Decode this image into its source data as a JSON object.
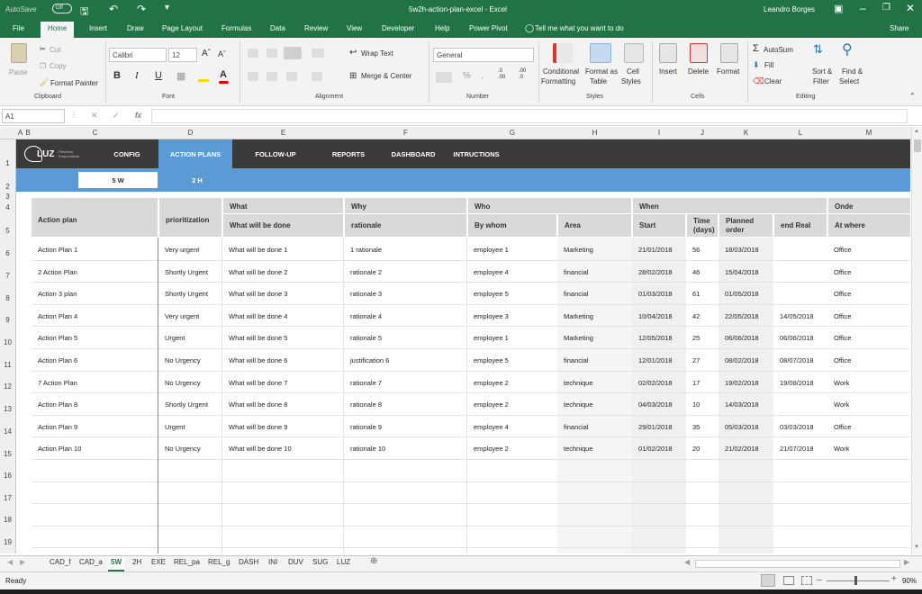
{
  "window": {
    "autosave": "AutoSave",
    "autosave_state": "Off",
    "title": "5w2h-action-plan-excel  -  Excel",
    "user": "Leandro Borges",
    "accent": "#217346"
  },
  "ribbon_tabs": [
    "File",
    "Home",
    "Insert",
    "Draw",
    "Page Layout",
    "Formulas",
    "Data",
    "Review",
    "View",
    "Developer",
    "Help",
    "Power Pivot"
  ],
  "tell_me": "Tell me what you want to do",
  "share": "Share",
  "ribbon": {
    "clipboard": {
      "paste": "Paste",
      "cut": "Cut",
      "copy": "Copy",
      "format_painter": "Format Painter",
      "group": "Clipboard"
    },
    "font": {
      "name": "Calibri",
      "size": "12",
      "group": "Font"
    },
    "alignment": {
      "wrap": "Wrap Text",
      "merge": "Merge & Center",
      "group": "Alignment"
    },
    "number": {
      "format": "General",
      "group": "Number"
    },
    "styles": {
      "conditional": "Conditional",
      "formatting": "Formatting",
      "format_as": "Format as",
      "table": "Table",
      "cell": "Cell",
      "cell_styles": "Styles",
      "group": "Styles"
    },
    "cells": {
      "insert": "Insert",
      "delete": "Delete",
      "format": "Format",
      "group": "Cells"
    },
    "editing": {
      "autosum": "AutoSum",
      "fill": "Fill",
      "clear": "Clear",
      "sort": "Sort &",
      "filter": "Filter",
      "find": "Find &",
      "select": "Select",
      "group": "Editing"
    }
  },
  "formula_bar": {
    "name_box": "A1",
    "fx": "fx",
    "value": ""
  },
  "columns": [
    "A",
    "B",
    "C",
    "D",
    "E",
    "F",
    "G",
    "H",
    "I",
    "J",
    "K",
    "L",
    "M"
  ],
  "rows": [
    "1",
    "2",
    "3",
    "4",
    "5",
    "6",
    "7",
    "8",
    "9",
    "10",
    "11",
    "12",
    "13",
    "14",
    "15",
    "16",
    "17",
    "18",
    "19"
  ],
  "sheet": {
    "logo": "LUZ",
    "logo_sub1": "Planilhas",
    "logo_sub2": "Empresariais",
    "nav": [
      "CONFIG",
      "ACTION PLANS",
      "FOLLOW-UP",
      "REPORTS",
      "DASHBOARD",
      "INTRUCTIONS"
    ],
    "subtabs": [
      "5 W",
      "2 H"
    ],
    "group_headers": {
      "what": "What",
      "why": "Why",
      "who": "Who",
      "when": "When",
      "onde": "Onde"
    },
    "headers": {
      "action_plan": "Action plan",
      "prioritization": "prioritization",
      "what_done": "What will be done",
      "rationale": "rationale",
      "by_whom": "By whom",
      "area": "Area",
      "start": "Start",
      "time": "Time (days)",
      "planned": "Planned order",
      "end_real": "end Real",
      "at_where": "At where"
    },
    "records": [
      [
        "Action Plan 1",
        "Very urgent",
        "What will be done 1",
        "1 rationale",
        "employee 1",
        "Marketing",
        "21/01/2018",
        "56",
        "18/03/2018",
        "",
        "Office"
      ],
      [
        "2 Action Plan",
        "Shortly Urgent",
        "What will be done 2",
        "rationale 2",
        "employee 4",
        "financial",
        "28/02/2018",
        "46",
        "15/04/2018",
        "",
        "Office"
      ],
      [
        "Action 3 plan",
        "Shortly Urgent",
        "What will be done 3",
        "rationale 3",
        "employee 5",
        "financial",
        "01/03/2018",
        "61",
        "01/05/2018",
        "",
        "Office"
      ],
      [
        "Action Plan 4",
        "Very urgent",
        "What will be done 4",
        "rationale 4",
        "employee 3",
        "Marketing",
        "10/04/2018",
        "42",
        "22/05/2018",
        "14/05/2018",
        "Office"
      ],
      [
        "Action Plan 5",
        "Urgent",
        "What will be done 5",
        "rationale 5",
        "employee 1",
        "Marketing",
        "12/05/2018",
        "25",
        "06/06/2018",
        "06/06/2018",
        "Office"
      ],
      [
        "Action Plan 6",
        "No Urgency",
        "What will be done 6",
        "justification 6",
        "employee 5",
        "financial",
        "12/01/2018",
        "27",
        "08/02/2018",
        "08/07/2018",
        "Office"
      ],
      [
        "7 Action Plan",
        "No Urgency",
        "What will be done 7",
        "rationale 7",
        "employee 2",
        "technique",
        "02/02/2018",
        "17",
        "19/02/2018",
        "19/08/2018",
        "Work"
      ],
      [
        "Action Plan 8",
        "Shortly Urgent",
        "What will be done 8",
        "rationale 8",
        "employee 2",
        "technique",
        "04/03/2018",
        "10",
        "14/03/2018",
        "",
        "Work"
      ],
      [
        "Action Plan 9",
        "Urgent",
        "What will be done 9",
        "rationale 9",
        "employee 4",
        "financial",
        "29/01/2018",
        "35",
        "05/03/2018",
        "03/03/2018",
        "Office"
      ],
      [
        "Action Plan 10",
        "No Urgency",
        "What will be done 10",
        "rationale 10",
        "employee 2",
        "technique",
        "01/02/2018",
        "20",
        "21/02/2018",
        "21/07/2018",
        "Work"
      ]
    ]
  },
  "sheet_tabs": [
    "CAD_f",
    "CAD_a",
    "5W",
    "2H",
    "EXE",
    "REL_pa",
    "REL_g",
    "DASH",
    "INI",
    "DUV",
    "SUG",
    "LUZ"
  ],
  "active_sheet": "5W",
  "status": {
    "ready": "Ready",
    "zoom": "90%"
  }
}
